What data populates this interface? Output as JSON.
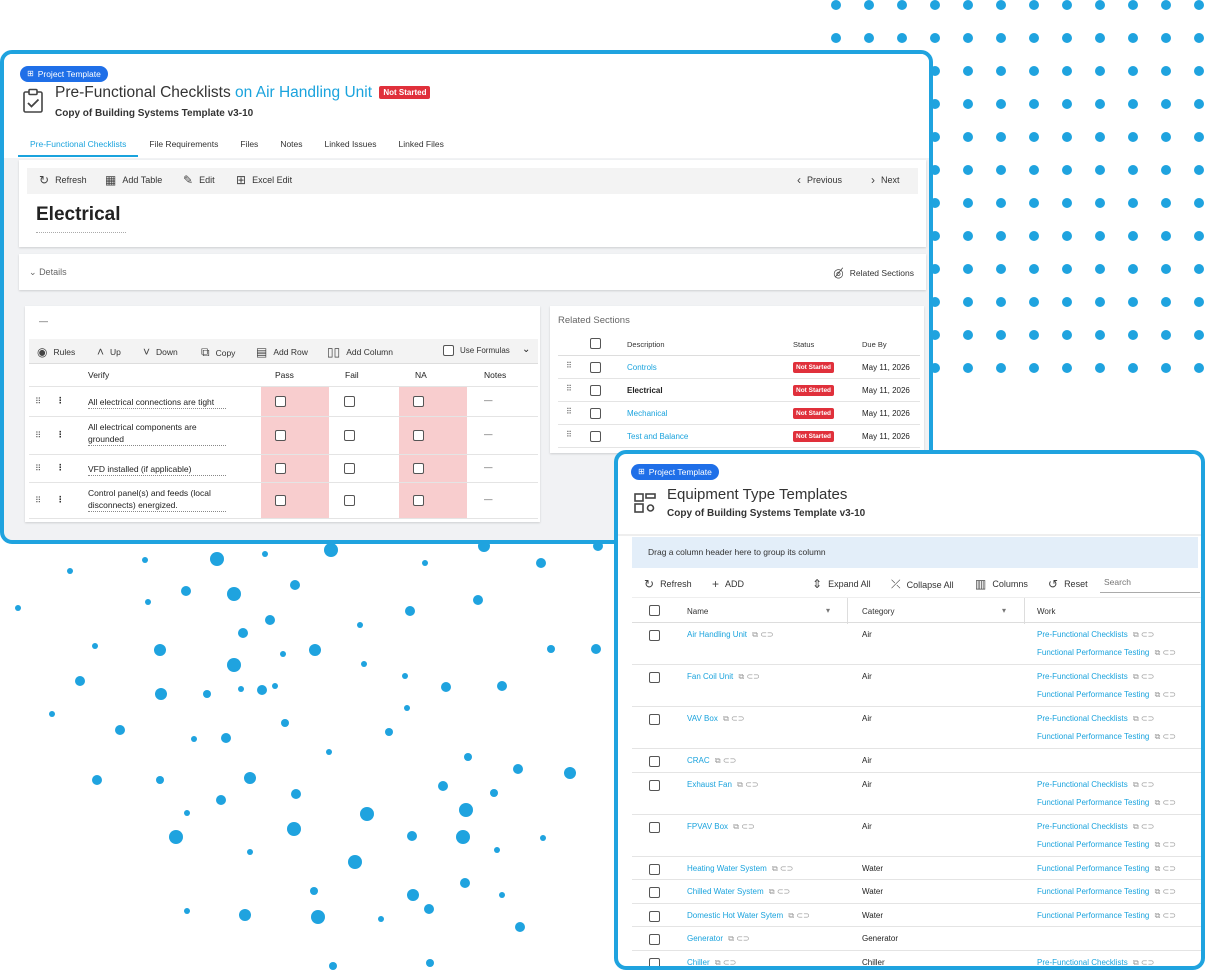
{
  "colors": {
    "accent": "#1aa3dd",
    "frame": "#1fa3df",
    "status_red": "#e0303b",
    "badge_blue": "#1f6fe8",
    "highlight_pink": "#f8cdce"
  },
  "w1": {
    "badge": "Project Template",
    "title": "Pre-Functional Checklists",
    "title_link": "on Air Handling Unit",
    "status": "Not Started",
    "subtitle": "Copy of Building Systems Template v3-10",
    "tabs": [
      "Pre-Functional Checklists",
      "File Requirements",
      "Files",
      "Notes",
      "Linked Issues",
      "Linked Files"
    ],
    "toolbar": {
      "refresh": "Refresh",
      "add_table": "Add Table",
      "edit": "Edit",
      "excel_edit": "Excel Edit",
      "previous": "Previous",
      "next": "Next"
    },
    "section_title": "Electrical",
    "details": "Details",
    "related_sections_toggle": "Related Sections",
    "table_dash": "—",
    "table_toolbar": {
      "rules": "Rules",
      "up": "Up",
      "down": "Down",
      "copy": "Copy",
      "add_row": "Add Row",
      "add_column": "Add Column",
      "use_formulas": "Use Formulas"
    },
    "columns": [
      "Verify",
      "Pass",
      "Fail",
      "NA",
      "Notes"
    ],
    "rows": [
      {
        "verify_1": "All electrical connections are tight",
        "verify_2": "",
        "notes": "—"
      },
      {
        "verify_1": "All electrical components are",
        "verify_2": "grounded",
        "notes": "—"
      },
      {
        "verify_1": "VFD installed (if applicable)",
        "verify_2": "",
        "notes": "—"
      },
      {
        "verify_1": "Control panel(s) and feeds (local",
        "verify_2": "disconnects) energized.",
        "notes": "—"
      }
    ],
    "related": {
      "title": "Related Sections",
      "columns": [
        "Description",
        "Status",
        "Due By"
      ],
      "rows": [
        {
          "description": "Controls",
          "status": "Not Started",
          "due": "May 11, 2026"
        },
        {
          "description": "Electrical",
          "status": "Not Started",
          "due": "May 11, 2026"
        },
        {
          "description": "Mechanical",
          "status": "Not Started",
          "due": "May 11, 2026"
        },
        {
          "description": "Test and Balance",
          "status": "Not Started",
          "due": "May 11, 2026"
        }
      ]
    }
  },
  "w2": {
    "badge": "Project Template",
    "title": "Equipment Type Templates",
    "subtitle": "Copy of Building Systems Template v3-10",
    "group_hint": "Drag a column header here to group its column",
    "toolbar": {
      "refresh": "Refresh",
      "add": "ADD",
      "expand_all": "Expand All",
      "collapse_all": "Collapse All",
      "columns": "Columns",
      "reset": "Reset",
      "search_placeholder": "Search"
    },
    "columns": [
      "Name",
      "Category",
      "Work"
    ],
    "rows": [
      {
        "name": "Air Handling Unit",
        "category": "Air",
        "work": [
          "Pre-Functional Checklists",
          "Functional Performance Testing"
        ]
      },
      {
        "name": "Fan Coil Unit",
        "category": "Air",
        "work": [
          "Pre-Functional Checklists",
          "Functional Performance Testing"
        ]
      },
      {
        "name": "VAV Box",
        "category": "Air",
        "work": [
          "Pre-Functional Checklists",
          "Functional Performance Testing"
        ]
      },
      {
        "name": "CRAC",
        "category": "Air",
        "work": []
      },
      {
        "name": "Exhaust Fan",
        "category": "Air",
        "work": [
          "Pre-Functional Checklists",
          "Functional Performance Testing"
        ]
      },
      {
        "name": "FPVAV Box",
        "category": "Air",
        "work": [
          "Pre-Functional Checklists",
          "Functional Performance Testing"
        ]
      },
      {
        "name": "Heating Water System",
        "category": "Water",
        "work": [
          "Functional Performance Testing"
        ]
      },
      {
        "name": "Chilled Water System",
        "category": "Water",
        "work": [
          "Functional Performance Testing"
        ]
      },
      {
        "name": "Domestic Hot Water Sytem",
        "category": "Water",
        "work": [
          "Functional Performance Testing"
        ]
      },
      {
        "name": "Generator",
        "category": "Generator",
        "work": []
      },
      {
        "name": "Chiller",
        "category": "Chiller",
        "work": [
          "Pre-Functional Checklists"
        ]
      }
    ]
  }
}
